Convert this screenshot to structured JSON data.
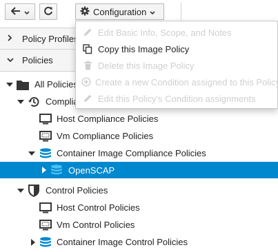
{
  "toolbar": {
    "back_icon": "arrow-left-icon",
    "refresh_icon": "refresh-icon",
    "configuration_label": "Configuration"
  },
  "accordion": {
    "policy_profiles_label": "Policy Profiles",
    "policies_label": "Policies"
  },
  "tree": {
    "all_policies": "All Policies",
    "compliance_policies": "Complia",
    "host_compliance_policies": "Host Compliance Policies",
    "vm_compliance_policies": "Vm Compliance Policies",
    "container_image_compliance_policies": "Container Image Compliance Policies",
    "openscap": "OpenSCAP",
    "control_policies": "Control Policies",
    "host_control_policies": "Host Control Policies",
    "vm_control_policies": "Vm Control Policies",
    "container_image_control_policies": "Container Image Control Policies"
  },
  "menu": {
    "items": [
      {
        "label": "Edit Basic Info, Scope, and Notes",
        "enabled": false,
        "icon": "pencil-icon"
      },
      {
        "label": "Copy this Image Policy",
        "enabled": true,
        "icon": "copy-icon"
      },
      {
        "label": "Delete this Image Policy",
        "enabled": false,
        "icon": "trash-icon"
      },
      {
        "label": "Create a new Condition assigned to this Policy",
        "enabled": false,
        "icon": "plus-circle-icon"
      },
      {
        "label": "Edit this Policy's Condition assignments",
        "enabled": false,
        "icon": "pencil-icon"
      }
    ]
  },
  "colors": {
    "selected_row": "#0088ce",
    "disabled_text": "#cfcfcf",
    "container_icon": "#0088ce"
  }
}
